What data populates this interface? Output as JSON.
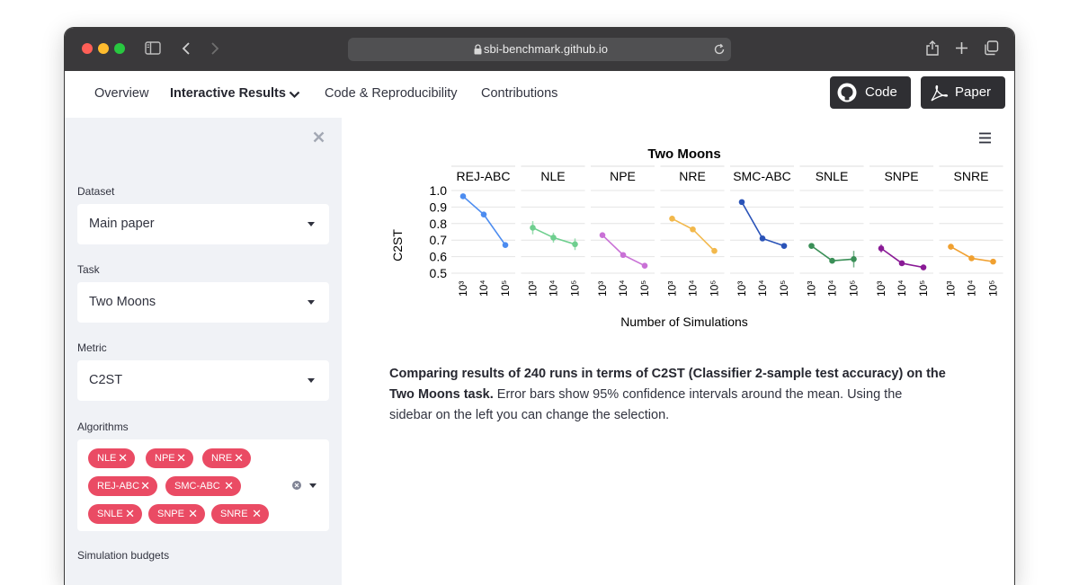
{
  "browser": {
    "url": "sbi-benchmark.github.io"
  },
  "nav": {
    "overview": "Overview",
    "interactive_results": "Interactive Results",
    "code_repro": "Code & Reproducibility",
    "contributions": "Contributions",
    "code_button": "Code",
    "paper_button": "Paper"
  },
  "sidebar": {
    "dataset_label": "Dataset",
    "dataset_value": "Main paper",
    "task_label": "Task",
    "task_value": "Two Moons",
    "metric_label": "Metric",
    "metric_value": "C2ST",
    "algorithms_label": "Algorithms",
    "algorithms": [
      "NLE",
      "NPE",
      "NRE",
      "REJ-ABC",
      "SMC-ABC",
      "SNLE",
      "SNPE",
      "SNRE"
    ],
    "sim_budgets_label": "Simulation budgets"
  },
  "chart_data": {
    "type": "line",
    "title": "Two Moons",
    "xlabel": "Number of Simulations",
    "ylabel": "C2ST",
    "ylim": [
      0.5,
      1.0
    ],
    "yticks": [
      "1.0",
      "0.9",
      "0.8",
      "0.7",
      "0.6",
      "0.5"
    ],
    "x": [
      "10³",
      "10⁴",
      "10⁵"
    ],
    "grid": true,
    "series": [
      {
        "name": "REJ-ABC",
        "color": "#4c8cf0",
        "values": [
          0.965,
          0.855,
          0.67
        ],
        "err": [
          0.0,
          0.0,
          0.0
        ]
      },
      {
        "name": "NLE",
        "color": "#6fcf8f",
        "values": [
          0.775,
          0.715,
          0.675
        ],
        "err": [
          0.04,
          0.03,
          0.035
        ]
      },
      {
        "name": "NPE",
        "color": "#c971d6",
        "values": [
          0.73,
          0.61,
          0.545
        ],
        "err": [
          0.015,
          0.0,
          0.0
        ]
      },
      {
        "name": "NRE",
        "color": "#f2b84b",
        "values": [
          0.83,
          0.765,
          0.635
        ],
        "err": [
          0.0,
          0.0,
          0.01
        ]
      },
      {
        "name": "SMC-ABC",
        "color": "#2a53b8",
        "values": [
          0.93,
          0.71,
          0.665
        ],
        "err": [
          0.0,
          0.01,
          0.015
        ]
      },
      {
        "name": "SNLE",
        "color": "#3a8f57",
        "values": [
          0.665,
          0.575,
          0.585
        ],
        "err": [
          0.0,
          0.015,
          0.05
        ]
      },
      {
        "name": "SNPE",
        "color": "#8a1a96",
        "values": [
          0.65,
          0.56,
          0.535
        ],
        "err": [
          0.025,
          0.0,
          0.0
        ]
      },
      {
        "name": "SNRE",
        "color": "#f0a030",
        "values": [
          0.66,
          0.59,
          0.57
        ],
        "err": [
          0.0,
          0.0,
          0.0
        ]
      }
    ]
  },
  "caption": {
    "bold": "Comparing results of 240 runs in terms of C2ST (Classifier 2-sample test accuracy) on the Two Moons task.",
    "rest": " Error bars show 95% confidence intervals around the mean. Using the sidebar on the left you can change the selection."
  }
}
